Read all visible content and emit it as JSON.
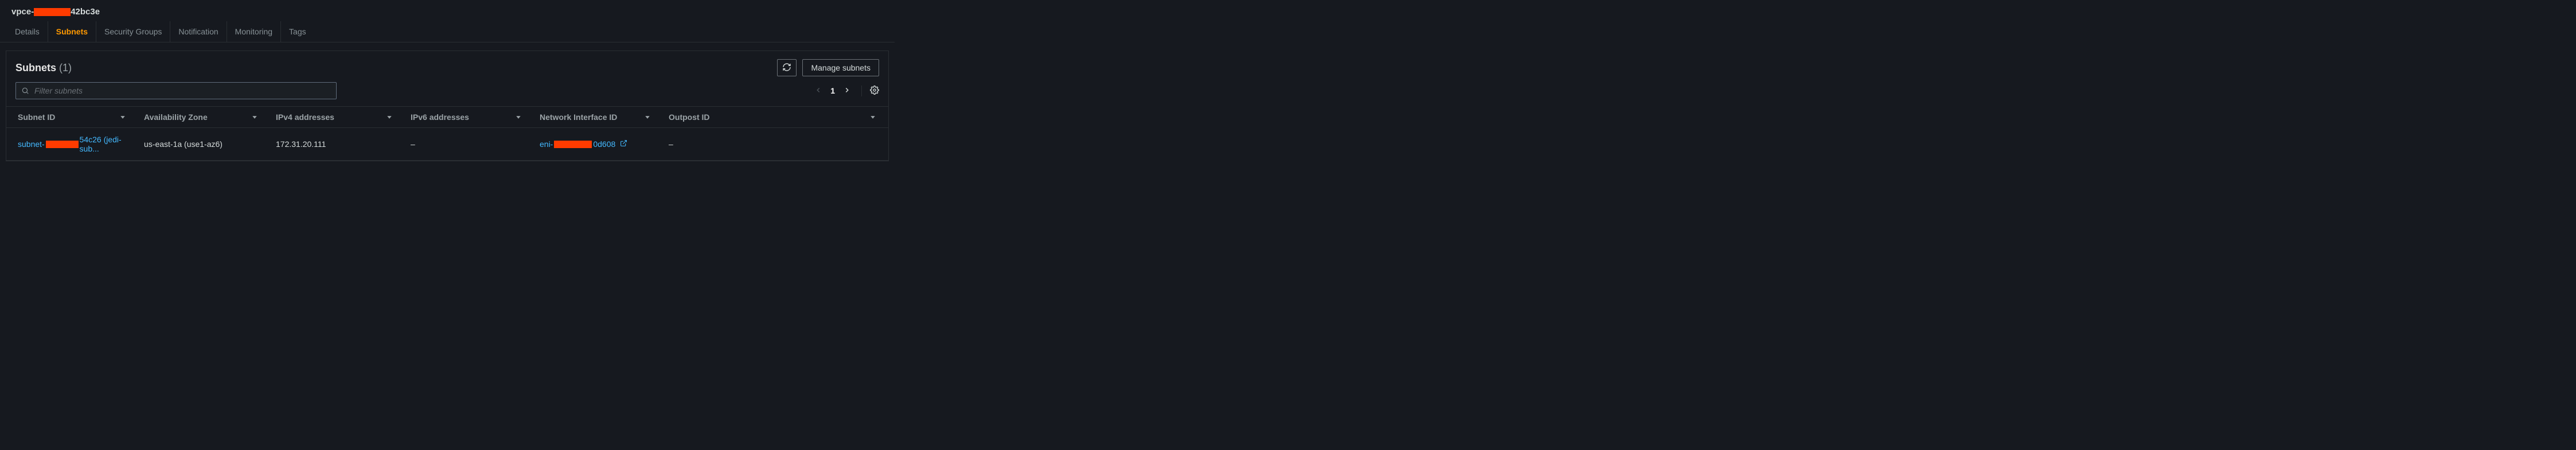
{
  "header": {
    "prefix": "vpce-",
    "suffix": "42bc3e"
  },
  "tabs": {
    "details": "Details",
    "subnets": "Subnets",
    "security_groups": "Security Groups",
    "notification": "Notification",
    "monitoring": "Monitoring",
    "tags": "Tags"
  },
  "panel": {
    "title": "Subnets",
    "count": "(1)",
    "refresh_label": "",
    "manage_label": "Manage subnets"
  },
  "filter": {
    "placeholder": "Filter subnets"
  },
  "pagination": {
    "page": "1"
  },
  "table": {
    "headers": {
      "subnet_id": "Subnet ID",
      "az": "Availability Zone",
      "ipv4": "IPv4 addresses",
      "ipv6": "IPv6 addresses",
      "eni": "Network Interface ID",
      "outpost": "Outpost ID"
    },
    "rows": [
      {
        "subnet_prefix": "subnet-",
        "subnet_suffix": "54c26 (jedi-sub...",
        "az": "us-east-1a (use1-az6)",
        "ipv4": "172.31.20.111",
        "ipv6": "–",
        "eni_prefix": "eni-",
        "eni_suffix": "0d608",
        "outpost": "–"
      }
    ]
  }
}
